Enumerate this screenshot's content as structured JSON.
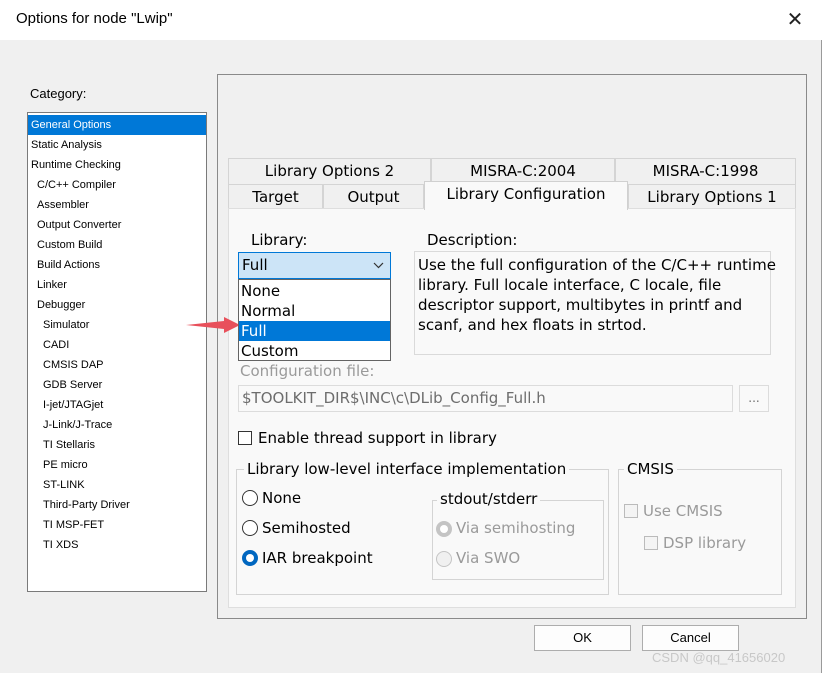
{
  "window": {
    "title": "Options for node \"Lwip\"",
    "close_glyph": "✕"
  },
  "category": {
    "label": "Category:",
    "items": [
      {
        "label": "General Options",
        "selected": true
      },
      {
        "label": "Static Analysis"
      },
      {
        "label": "Runtime Checking"
      },
      {
        "label": "C/C++ Compiler"
      },
      {
        "label": "Assembler"
      },
      {
        "label": "Output Converter"
      },
      {
        "label": "Custom Build"
      },
      {
        "label": "Build Actions"
      },
      {
        "label": "Linker"
      },
      {
        "label": "Debugger"
      },
      {
        "label": "Simulator"
      },
      {
        "label": "CADI"
      },
      {
        "label": "CMSIS DAP"
      },
      {
        "label": "GDB Server"
      },
      {
        "label": "I-jet/JTAGjet"
      },
      {
        "label": "J-Link/J-Trace"
      },
      {
        "label": "TI Stellaris"
      },
      {
        "label": "PE micro"
      },
      {
        "label": "ST-LINK"
      },
      {
        "label": "Third-Party Driver"
      },
      {
        "label": "TI MSP-FET"
      },
      {
        "label": "TI XDS"
      }
    ]
  },
  "tabs": {
    "row1": [
      "Library Options 2",
      "MISRA-C:2004",
      "MISRA-C:1998"
    ],
    "row2": [
      "Target",
      "Output",
      "Library Configuration",
      "Library Options 1"
    ],
    "active": "Library Configuration"
  },
  "library": {
    "label": "Library:",
    "selected": "Full",
    "chevron": "⌄",
    "options": [
      "None",
      "Normal",
      "Full",
      "Custom"
    ]
  },
  "description": {
    "label": "Description:",
    "lines": [
      "Use the full configuration of the C/C++ runtime",
      "library. Full locale interface, C locale, file",
      "descriptor support, multibytes in printf and",
      "scanf, and hex floats in strtod."
    ]
  },
  "config_file": {
    "label": "Configuration file:",
    "value": "$TOOLKIT_DIR$\\INC\\c\\DLib_Config_Full.h",
    "browse_label": "..."
  },
  "thread_support": {
    "label": "Enable thread support in library",
    "checked": false
  },
  "low_level": {
    "title": "Library low-level interface implementation",
    "options": [
      "None",
      "Semihosted",
      "IAR breakpoint"
    ],
    "selected": "IAR breakpoint"
  },
  "stdout": {
    "title": "stdout/stderr",
    "options": [
      "Via semihosting",
      "Via SWO"
    ],
    "selected": "Via semihosting"
  },
  "cmsis": {
    "title": "CMSIS",
    "use_cmsis": "Use CMSIS",
    "dsp_library": "DSP library"
  },
  "buttons": {
    "ok": "OK",
    "cancel": "Cancel"
  },
  "watermark": "CSDN @qq_41656020",
  "colors": {
    "accent": "#0078d7",
    "arrow": "#e8505b"
  }
}
